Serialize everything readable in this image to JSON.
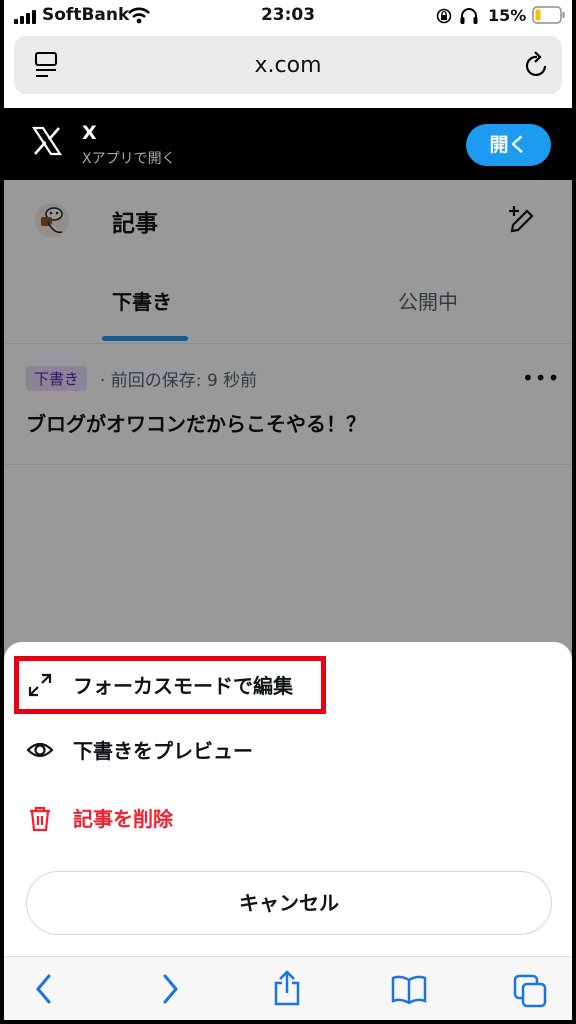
{
  "status": {
    "carrier": "SoftBank",
    "time": "23:03",
    "battery": "15%"
  },
  "browser": {
    "url": "x.com"
  },
  "banner": {
    "title": "X",
    "subtitle": "Xアプリで開く",
    "open_label": "開く"
  },
  "page": {
    "title": "記事",
    "tabs": [
      {
        "label": "下書き",
        "active": true
      },
      {
        "label": "公開中",
        "active": false
      }
    ],
    "draft": {
      "badge": "下書き",
      "saved": "· 前回の保存: 9 秒前",
      "more": "•••",
      "title": "ブログがオワコンだからこそやる！？"
    }
  },
  "sheet": {
    "items": [
      {
        "label": "フォーカスモードで編集",
        "icon": "expand-icon"
      },
      {
        "label": "下書きをプレビュー",
        "icon": "eye-icon"
      },
      {
        "label": "記事を削除",
        "icon": "trash-icon"
      }
    ],
    "cancel_label": "キャンセル"
  },
  "colors": {
    "accent": "#1d9bf0",
    "danger": "#f4212e",
    "highlight": "#e60012"
  }
}
